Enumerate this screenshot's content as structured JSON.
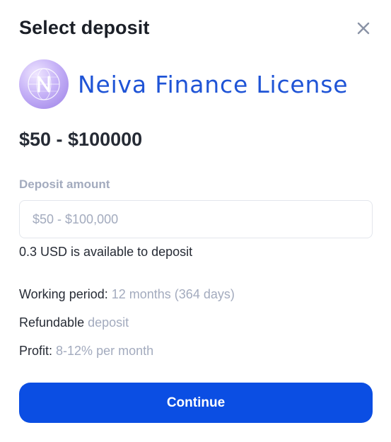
{
  "modal": {
    "title": "Select deposit",
    "close_icon": "close-icon"
  },
  "product": {
    "logo_icon": "globe-logo-icon",
    "name": "Neiva Finance License",
    "name_color": "#1f54d6"
  },
  "price_range": "$50 - $100000",
  "deposit": {
    "label": "Deposit amount",
    "value": "",
    "placeholder": "$50 - $100,000",
    "available_text": "0.3 USD is available to deposit"
  },
  "details": {
    "period_label": "Working period:",
    "period_value": "12 months (364 days)",
    "refund_label": "Refundable",
    "refund_value": "deposit",
    "profit_label": "Profit:",
    "profit_value": "8-12% per month"
  },
  "actions": {
    "continue_label": "Continue",
    "button_color": "#0b4ee3"
  }
}
